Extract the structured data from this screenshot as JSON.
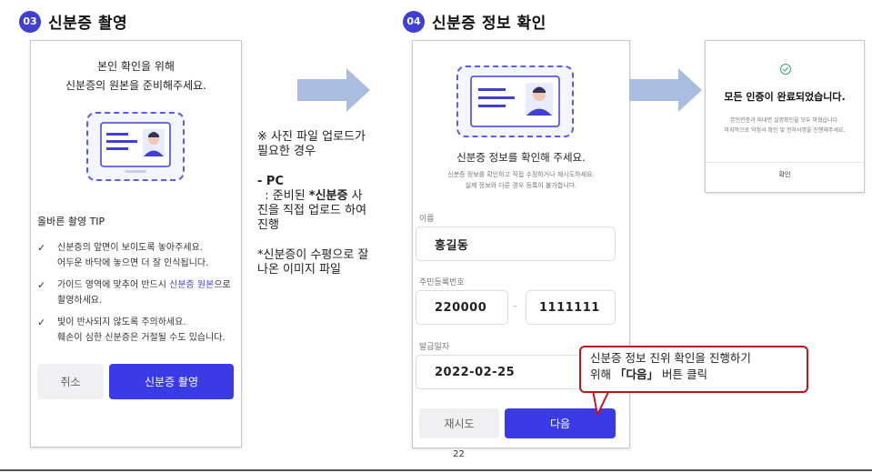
{
  "step3": {
    "number": "03",
    "title": "신분증 촬영",
    "heading_line1": "본인 확인을 위해",
    "heading_line2": "신분증의 원본을 준비해주세요.",
    "tip_title": "올바른 촬영 TIP",
    "tip1_line1": "신분증의 앞면이 보이도록 놓아주세요.",
    "tip1_line2": "어두운 바닥에 놓으면 더 잘 인식됩니다.",
    "tip2_line1a": "가이드 영역에 맞추어 반드시 ",
    "tip2_accent": "신분증 원본",
    "tip2_line1b": "으로",
    "tip2_line2": "촬영하세요.",
    "tip3_line1": "빛이 반사되지 않도록 주의하세요.",
    "tip3_line2": "훼손이 심한 신분증은 거절될 수도 있습니다.",
    "cancel_label": "취소",
    "capture_label": "신분증 촬영"
  },
  "note": {
    "line1": "※ 사진 파일 업로드가",
    "line2": "필요한 경우",
    "pc_title": "- PC",
    "pc_line1a": "  : 준비된 ",
    "pc_bold": "*신분증",
    "pc_line1b": " 사",
    "pc_line2": "진을 직접 업로드 하여",
    "pc_line3": "진행",
    "foot_line1": "*신분증이 수평으로 잘",
    "foot_line2": "나온 이미지 파일"
  },
  "step4": {
    "number": "04",
    "title": "신분증 정보 확인",
    "heading": "신분증 정보를 확인해 주세요.",
    "sub_line1": "신분증 정보를 확인하고 직접 수정하거나 재시도하세요.",
    "sub_line2": "실제 정보와 다른 경우 등록이 불가합니다.",
    "name_label": "이름",
    "name_value": "홍길동",
    "rrn_label": "주민등록번호",
    "rrn_front": "220000",
    "rrn_dash": "-",
    "rrn_back": "1111111",
    "date_label": "발급일자",
    "date_value": "2022-02-25",
    "retry_label": "재시도",
    "next_label": "다음"
  },
  "done": {
    "title": "모든 인증이 완료되었습니다.",
    "line1": "본인인증과 비대면 실명확인을 모두 마쳤습니다.",
    "line2": "마지막으로 약정서 확인 및 전자서명을 진행해주세요.",
    "confirm_label": "확인"
  },
  "callout": {
    "line1": "신분증 정보 진위 확인을 진행하기",
    "line2a": "위해 ",
    "line2_bold": "「다음」",
    "line2b": " 버튼 클릭"
  },
  "page_number": "22",
  "colors": {
    "accent": "#3f3fd6",
    "button_blue": "#3a3ae6",
    "arrow": "#a9bde0",
    "callout_border": "#c0141c",
    "success": "#2eaa5c"
  }
}
